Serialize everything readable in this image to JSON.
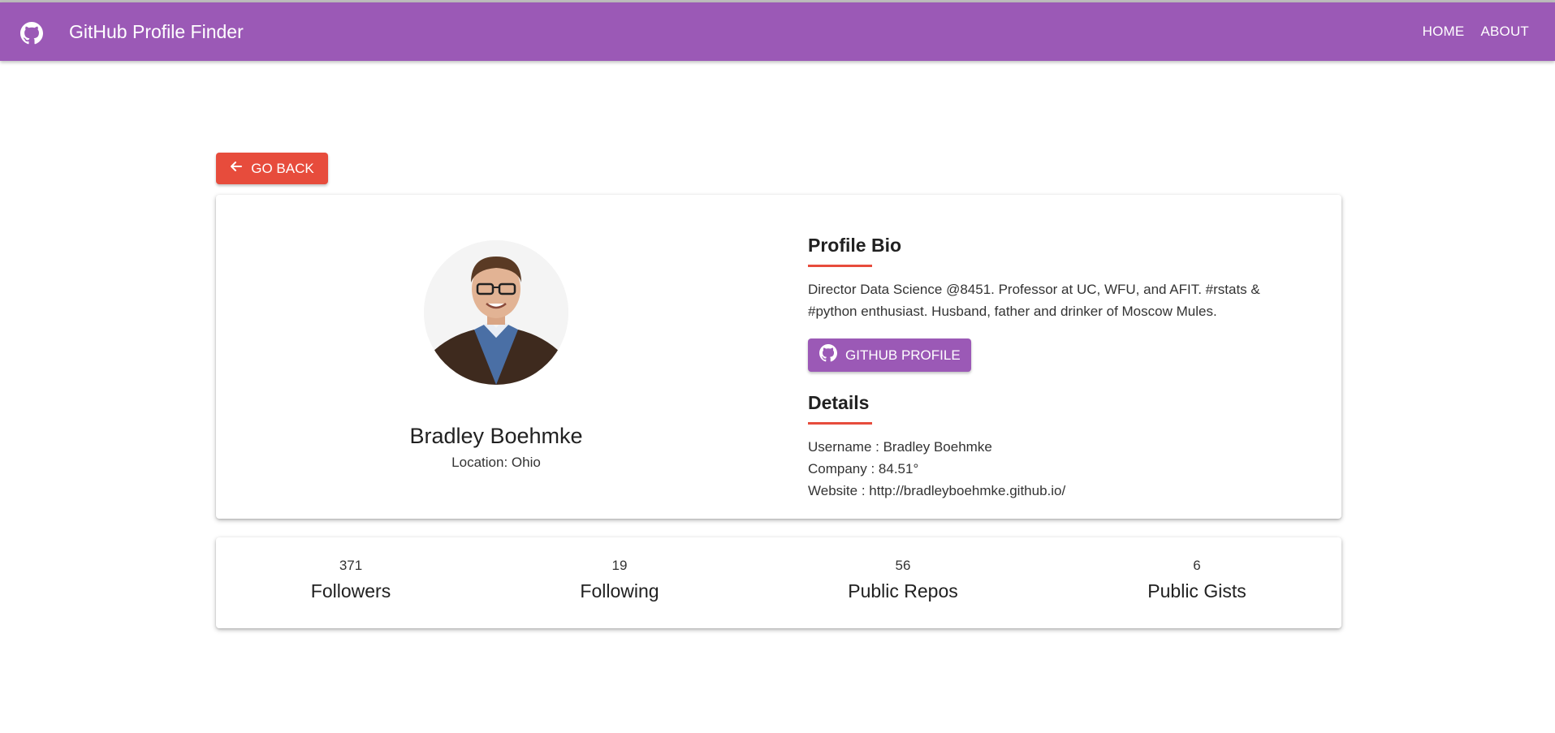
{
  "appbar": {
    "title": "GitHub Profile Finder",
    "nav": {
      "home": "HOME",
      "about": "ABOUT"
    },
    "color": "#9b59b6"
  },
  "go_back": {
    "label": "GO BACK",
    "icon": "arrow-left-icon",
    "color": "#e74c3c"
  },
  "profile": {
    "name": "Bradley Boehmke",
    "location": "Location: Ohio"
  },
  "bio": {
    "title": "Profile Bio",
    "text": "Director Data Science @8451. Professor at UC, WFU, and AFIT. #rstats & #python enthusiast. Husband, father and drinker of Moscow Mules."
  },
  "github_button": {
    "label": "GITHUB PROFILE",
    "icon": "github-icon"
  },
  "details": {
    "title": "Details",
    "username": "Username : Bradley Boehmke",
    "company": "Company : 84.51°",
    "website": "Website : http://bradleyboehmke.github.io/"
  },
  "stats": [
    {
      "value": "371",
      "label": "Followers"
    },
    {
      "value": "19",
      "label": "Following"
    },
    {
      "value": "56",
      "label": "Public Repos"
    },
    {
      "value": "6",
      "label": "Public Gists"
    }
  ],
  "accent_color": "#e74c3c"
}
